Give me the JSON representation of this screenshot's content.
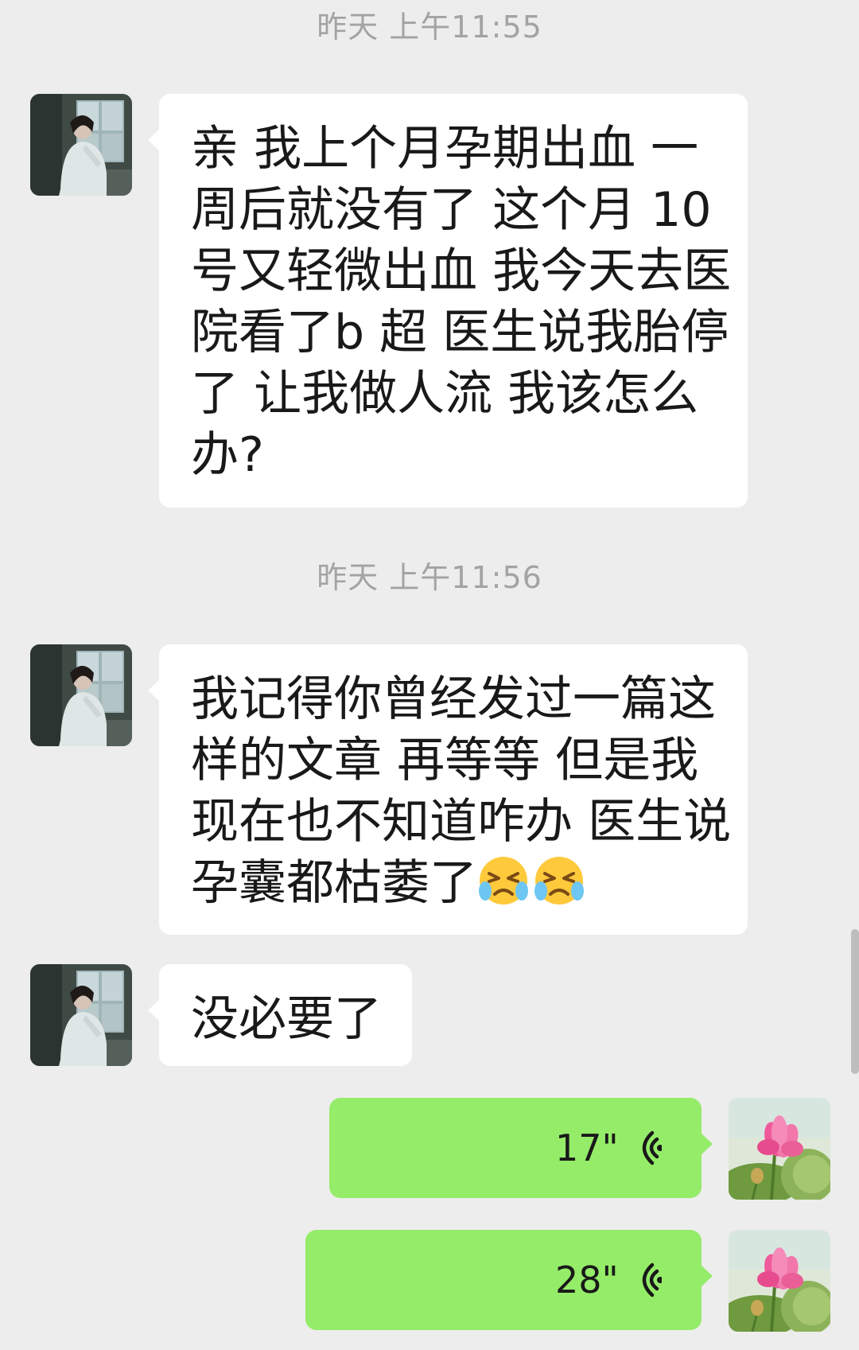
{
  "timestamps": [
    "昨天 上午11:55",
    "昨天 上午11:56"
  ],
  "messages": [
    {
      "sender": "contact",
      "lines": [
        "亲 我上个月孕期出血 一",
        "周后就没有了  这个月 10",
        "号又轻微出血 我今天去医",
        "院看了b 超 医生说我胎停",
        "了 让我做人流   我该怎么",
        "办?"
      ]
    },
    {
      "sender": "contact",
      "lines": [
        "我记得你曾经发过一篇这",
        "样的文章 再等等 但是我",
        "现在也不知道咋办 医生说",
        "孕囊都枯萎了"
      ],
      "emoji": [
        "crying-face-icon",
        "crying-face-icon"
      ]
    },
    {
      "sender": "contact",
      "lines": [
        "没必要了"
      ]
    },
    {
      "sender": "me",
      "type": "voice",
      "duration": "17\""
    },
    {
      "sender": "me",
      "type": "voice",
      "duration": "28\""
    }
  ],
  "colors": {
    "background": "#ededed",
    "incoming_bubble": "#ffffff",
    "outgoing_bubble": "#95ec69",
    "timestamp_text": "#a3a3a3",
    "message_text": "#191919"
  },
  "icons": {
    "contact_avatar": "contact-avatar-photo",
    "my_avatar": "lotus-flower-avatar",
    "voice": "voice-wave-icon",
    "emoji": "crying-face-icon"
  }
}
